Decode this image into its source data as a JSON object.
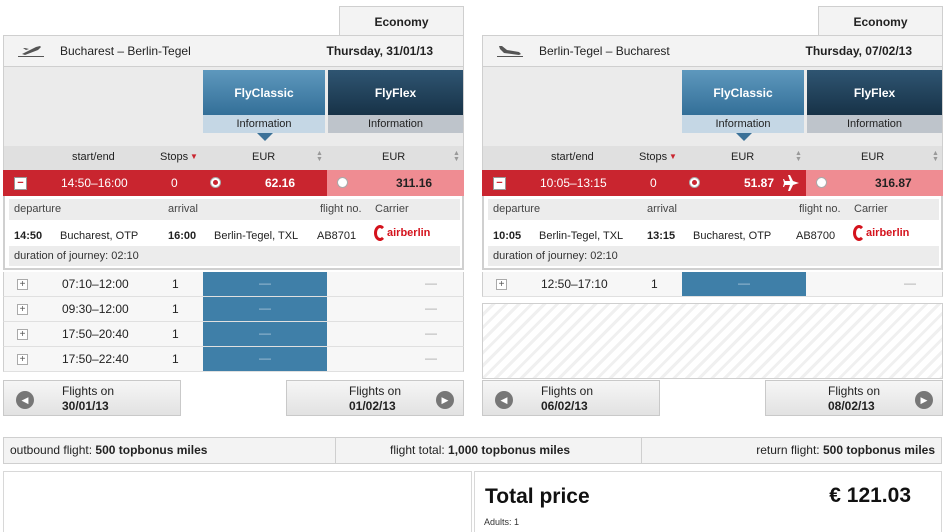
{
  "cabin_label": "Economy",
  "fare_families": [
    {
      "name": "FlyClassic",
      "info": "Information"
    },
    {
      "name": "FlyFlex",
      "info": "Information"
    }
  ],
  "columns": {
    "startend": "start/end",
    "stops": "Stops",
    "cur1": "EUR",
    "cur2": "EUR"
  },
  "detail_headers": {
    "departure": "departure",
    "arrival": "arrival",
    "flightno": "flight no.",
    "carrier": "Carrier"
  },
  "carrier_logo_text": "airberlin",
  "outbound": {
    "route": "Bucharest – Berlin-Tegel",
    "date": "Thursday, 31/01/13",
    "selected": {
      "times": "14:50–16:00",
      "stops": "0",
      "price_classic": "62.16",
      "price_flex": "311.16"
    },
    "detail": {
      "dep_time": "14:50",
      "dep_place": "Bucharest, OTP",
      "arr_time": "16:00",
      "arr_place": "Berlin-Tegel, TXL",
      "flight_no": "AB8701",
      "duration": "duration of journey: 02:10"
    },
    "rows": [
      {
        "times": "07:10–12:00",
        "stops": "1",
        "classic": "—",
        "flex": "—"
      },
      {
        "times": "09:30–12:00",
        "stops": "1",
        "classic": "—",
        "flex": "—"
      },
      {
        "times": "17:50–20:40",
        "stops": "1",
        "classic": "—",
        "flex": "—"
      },
      {
        "times": "17:50–22:40",
        "stops": "1",
        "classic": "—",
        "flex": "—"
      }
    ],
    "prev": {
      "label": "Flights on",
      "date": "30/01/13"
    },
    "next": {
      "label": "Flights on",
      "date": "01/02/13"
    }
  },
  "return": {
    "route": "Berlin-Tegel – Bucharest",
    "date": "Thursday, 07/02/13",
    "selected": {
      "times": "10:05–13:15",
      "stops": "0",
      "price_classic": "51.87",
      "price_flex": "316.87"
    },
    "detail": {
      "dep_time": "10:05",
      "dep_place": "Berlin-Tegel, TXL",
      "arr_time": "13:15",
      "arr_place": "Bucharest, OTP",
      "flight_no": "AB8700",
      "duration": "duration of journey: 02:10"
    },
    "rows": [
      {
        "times": "12:50–17:10",
        "stops": "1",
        "classic": "—",
        "flex": "—"
      }
    ],
    "prev": {
      "label": "Flights on",
      "date": "06/02/13"
    },
    "next": {
      "label": "Flights on",
      "date": "08/02/13"
    }
  },
  "miles": {
    "outbound_label": "outbound flight:",
    "outbound_value": "500 topbonus miles",
    "total_label": "flight total:",
    "total_value": "1,000 topbonus miles",
    "return_label": "return flight:",
    "return_value": "500 topbonus miles"
  },
  "total": {
    "label": "Total price",
    "value": "€ 121.03",
    "adults": "Adults: 1"
  },
  "colors": {
    "selected_red": "#c9252f",
    "classic_blue": "#3f7fa8",
    "flex_navy": "#173247"
  }
}
